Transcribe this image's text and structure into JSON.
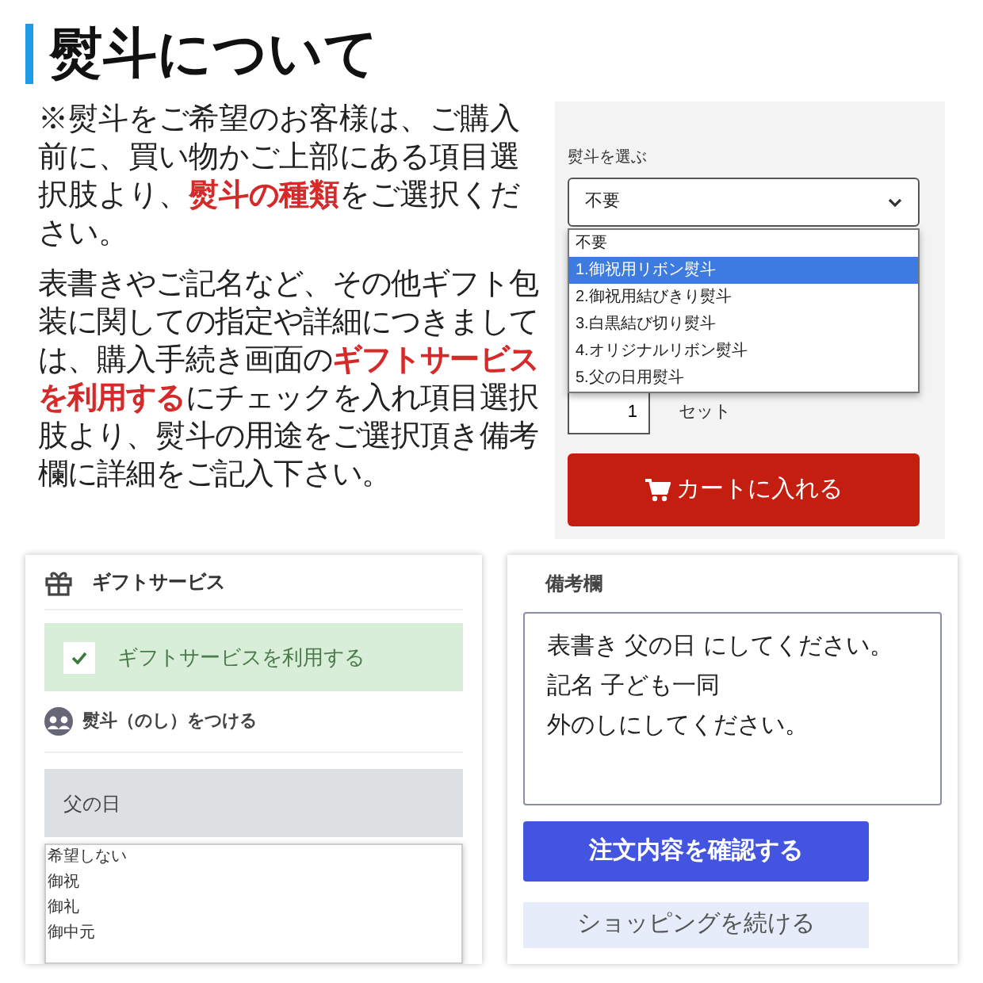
{
  "title": "熨斗について",
  "paragraphs": [
    "※熨斗をご希望のお客様は、ご購入前に、買い物かご上部にある項目選択肢より、**熨斗の種類**をご選択ください。",
    "表書きやご記名など、その他ギフト包装に関しての指定や詳細につきましては、購入手続き画面の**ギフトサービスを利用する**にチェックを入れ項目選択肢より、熨斗の用途をご選択頂き備考欄に詳細をご記入下さい。"
  ],
  "product_form": {
    "label": "熨斗を選ぶ",
    "select_value": "不要",
    "options": [
      {
        "label": "不要",
        "selected": false
      },
      {
        "label": "1.御祝用リボン熨斗",
        "selected": true
      },
      {
        "label": "2.御祝用結びきり熨斗",
        "selected": false
      },
      {
        "label": "3.白黒結び切り熨斗",
        "selected": false
      },
      {
        "label": "4.オリジナルリボン熨斗",
        "selected": false
      },
      {
        "label": "5.父の日用熨斗",
        "selected": false
      }
    ],
    "quantity": "1",
    "unit": "セット",
    "cart_button": "カートに入れる"
  },
  "gift_service": {
    "heading": "ギフトサービス",
    "checkbox": {
      "label": "ギフトサービスを利用する",
      "checked": true
    },
    "noshi_label": "熨斗（のし）をつける",
    "select_value": "父の日",
    "options": [
      "希望しない",
      "御祝",
      "御礼",
      "御中元"
    ]
  },
  "notes": {
    "heading": "備考欄",
    "lines": [
      "表書き 父の日 にしてください。",
      "記名 子ども一同",
      "外のしにしてください。"
    ],
    "confirm_button": "注文内容を確認する",
    "continue_button": "ショッピングを続ける"
  }
}
